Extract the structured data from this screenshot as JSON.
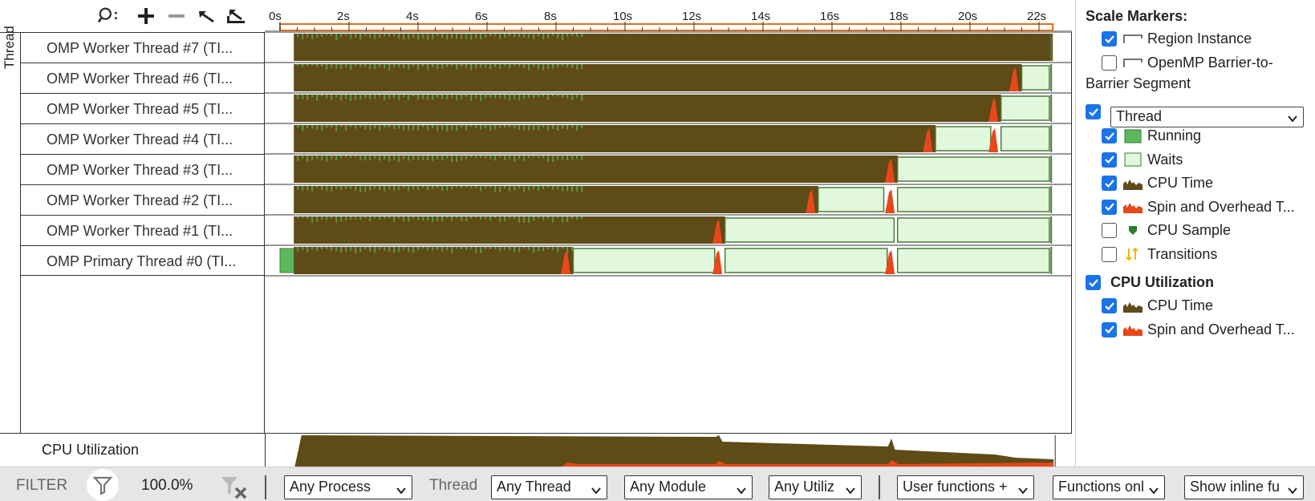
{
  "toolbar": {
    "icons": [
      "search-icon",
      "zoom-in-icon",
      "zoom-out-icon",
      "undo-zoom-icon",
      "reset-zoom-icon"
    ]
  },
  "ruler": {
    "ticks": [
      "0s",
      "2s",
      "4s",
      "6s",
      "8s",
      "10s",
      "12s",
      "14s",
      "16s",
      "18s",
      "20s",
      "22s"
    ]
  },
  "thread_axis_label": "Thread",
  "threads": [
    {
      "name": "OMP Worker Thread #7 (TI...",
      "spin_at": [],
      "waits": []
    },
    {
      "name": "OMP Worker Thread #6 (TI...",
      "spin_at": [
        21.3
      ],
      "waits": [
        [
          21.5,
          22.3
        ]
      ]
    },
    {
      "name": "OMP Worker Thread #5 (TI...",
      "spin_at": [
        20.7
      ],
      "waits": [
        [
          20.9,
          22.3
        ]
      ]
    },
    {
      "name": "OMP Worker Thread #4 (TI...",
      "spin_at": [
        18.8,
        20.7
      ],
      "waits": [
        [
          19.0,
          20.6
        ],
        [
          20.9,
          22.3
        ]
      ]
    },
    {
      "name": "OMP Worker Thread #3 (TI...",
      "spin_at": [
        17.7
      ],
      "waits": [
        [
          17.9,
          22.3
        ]
      ]
    },
    {
      "name": "OMP Worker Thread #2 (TI...",
      "spin_at": [
        15.4,
        17.7
      ],
      "waits": [
        [
          15.6,
          17.5
        ],
        [
          17.9,
          22.3
        ]
      ]
    },
    {
      "name": "OMP Worker Thread #1 (TI...",
      "spin_at": [
        12.7
      ],
      "waits": [
        [
          12.9,
          17.8
        ],
        [
          17.9,
          22.3
        ]
      ]
    },
    {
      "name": "OMP Primary Thread #0 (TI...",
      "spin_at": [
        8.3,
        12.7,
        17.7
      ],
      "waits": [
        [
          8.5,
          12.6
        ],
        [
          12.9,
          17.6
        ],
        [
          17.9,
          22.3
        ]
      ],
      "running_head": [
        0,
        0.4
      ]
    }
  ],
  "cpu_row": {
    "label": "CPU Utilization"
  },
  "legend": {
    "scale_markers_title": "Scale Markers:",
    "region_instance": {
      "label": "Region Instance",
      "checked": true
    },
    "openmp_barrier": {
      "label": "OpenMP Barrier-to-Barrier Segment",
      "line1": "OpenMP Barrier-to-",
      "line2": "Barrier Segment",
      "checked": false
    },
    "thread_group": {
      "label": "Thread",
      "checked": true
    },
    "thread_items": [
      {
        "label": "Running",
        "checked": true,
        "swatch": "running"
      },
      {
        "label": "Waits",
        "checked": true,
        "swatch": "waits"
      },
      {
        "label": "CPU Time",
        "checked": true,
        "swatch": "cputime"
      },
      {
        "label": "Spin and Overhead T...",
        "checked": true,
        "swatch": "spin"
      },
      {
        "label": "CPU Sample",
        "checked": false,
        "swatch": "sample"
      },
      {
        "label": "Transitions",
        "checked": false,
        "swatch": "transitions"
      }
    ],
    "cpu_util_title": "CPU Utilization",
    "cpu_util_checked": true,
    "cpu_items": [
      {
        "label": "CPU Time",
        "checked": true,
        "swatch": "cputime"
      },
      {
        "label": "Spin and Overhead T...",
        "checked": true,
        "swatch": "spin"
      }
    ]
  },
  "filterbar": {
    "label": "FILTER",
    "percent": "100.0%",
    "process": "Any Process",
    "thread_label": "Thread",
    "thread": "Any Thread",
    "module": "Any Module",
    "utilization": "Any Utiliz",
    "functions": "User functions +",
    "functions_only": "Functions onl",
    "inline": "Show inline fu"
  },
  "colors": {
    "cpu_time": "#5f4b16",
    "spin": "#e8471a",
    "running": "#5cb85c",
    "waits": "#e2f8dc",
    "wait_border": "#4c7a3a",
    "accent": "#1a73e8",
    "ruler_selection": "#e07020"
  },
  "timeline": {
    "max_seconds": 22.4
  }
}
